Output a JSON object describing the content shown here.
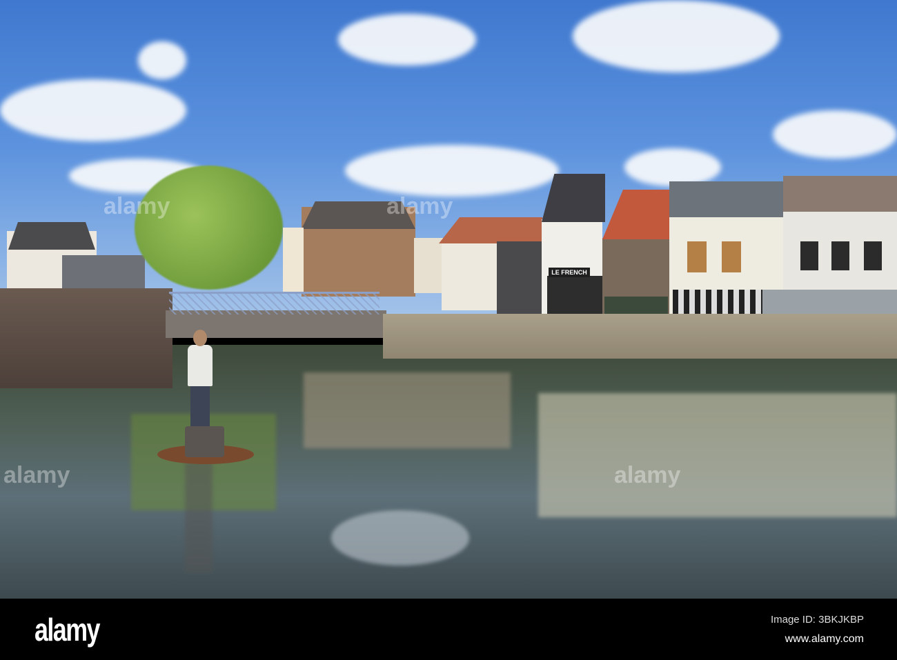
{
  "photo": {
    "storefront_sign": "LE FRENCH",
    "watermark": "alamy"
  },
  "footer": {
    "logo": "alamy",
    "image_id": "Image ID: 3BKJKBP",
    "website": "www.alamy.com"
  },
  "colors": {
    "sky": "#5d93de",
    "water": "#4f5f55",
    "footer": "#000000"
  }
}
